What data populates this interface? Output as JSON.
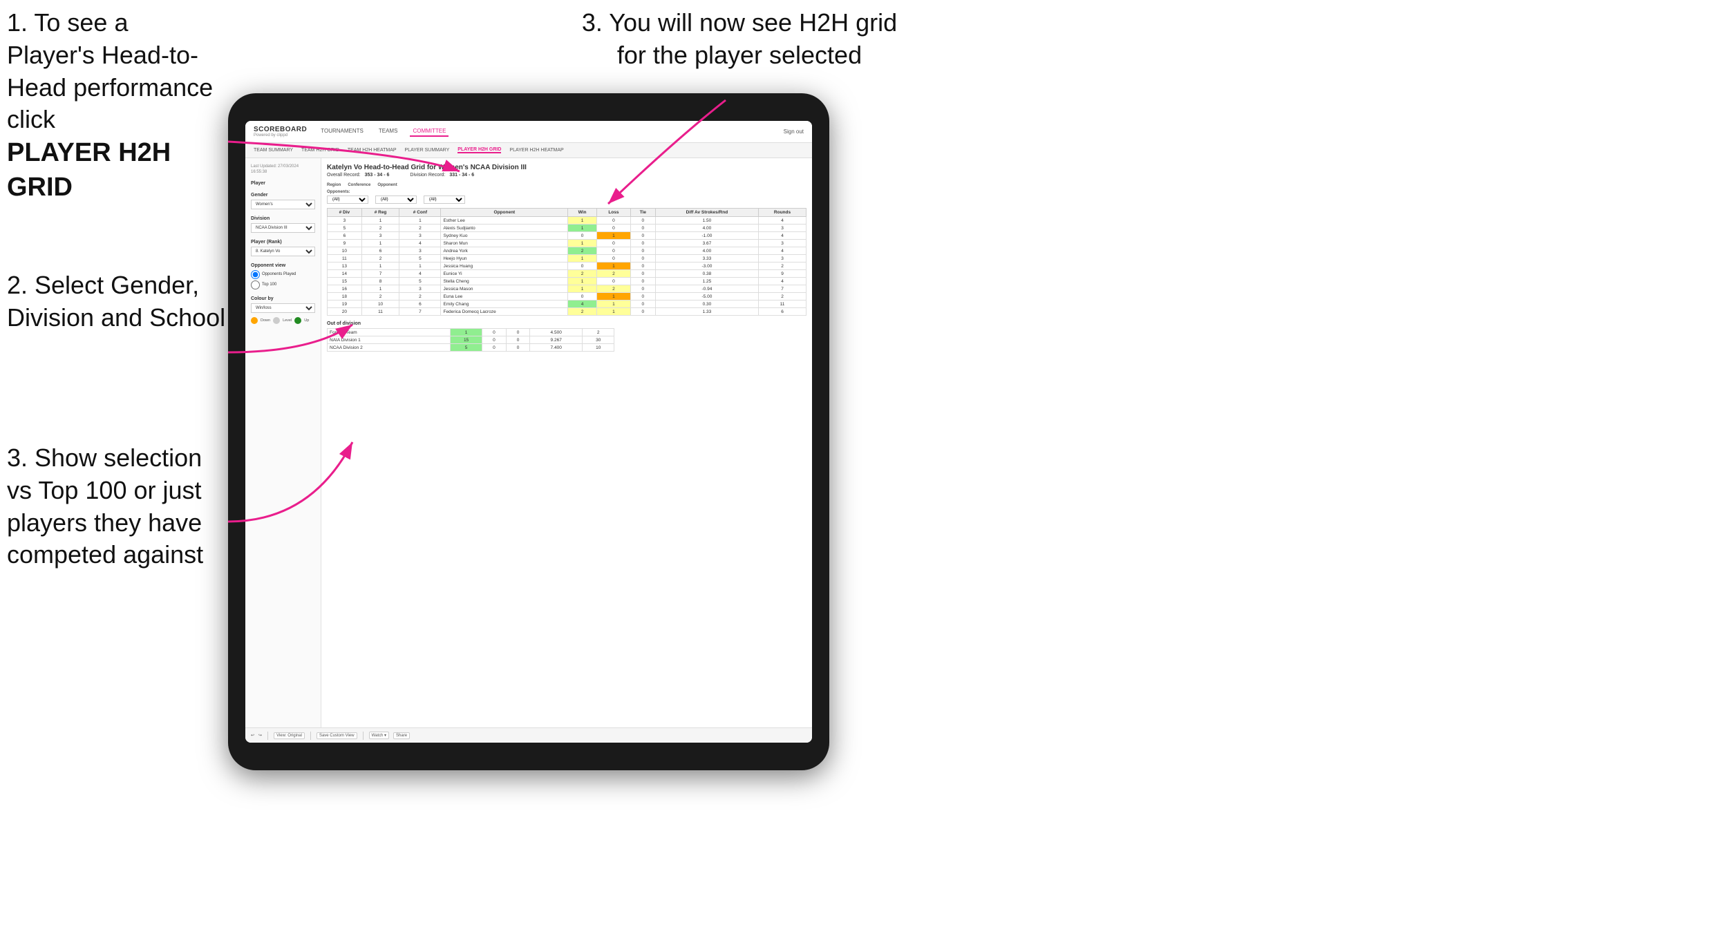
{
  "instructions": {
    "top_left_1": "1. To see a Player's Head-to-Head performance click",
    "top_left_1_bold": "PLAYER H2H GRID",
    "mid_left_2": "2. Select Gender, Division and School",
    "bot_left_3": "3. Show selection vs Top 100 or just players they have competed against",
    "top_right_3": "3. You will now see H2H grid for the player selected"
  },
  "nav": {
    "logo": "SCOREBOARD",
    "logo_sub": "Powered by clippd",
    "links": [
      "TOURNAMENTS",
      "TEAMS",
      "COMMITTEE"
    ],
    "active_link": "COMMITTEE",
    "sign_out": "Sign out"
  },
  "sub_nav": {
    "links": [
      "TEAM SUMMARY",
      "TEAM H2H GRID",
      "TEAM H2H HEATMAP",
      "PLAYER SUMMARY",
      "PLAYER H2H GRID",
      "PLAYER H2H HEATMAP"
    ],
    "active": "PLAYER H2H GRID"
  },
  "left_panel": {
    "last_updated_label": "Last Updated: 27/03/2024",
    "last_updated_time": "16:55:38",
    "player_label": "Player",
    "gender_label": "Gender",
    "gender_value": "Women's",
    "division_label": "Division",
    "division_value": "NCAA Division III",
    "player_rank_label": "Player (Rank)",
    "player_rank_value": "8. Katelyn Vo",
    "opponent_view_label": "Opponent view",
    "radio_opponents": "Opponents Played",
    "radio_top100": "Top 100",
    "colour_by_label": "Colour by",
    "colour_by_value": "Win/loss",
    "legend_down": "Down",
    "legend_level": "Level",
    "legend_up": "Up"
  },
  "grid": {
    "title": "Katelyn Vo Head-to-Head Grid for Women's NCAA Division III",
    "overall_record_label": "Overall Record:",
    "overall_record": "353 - 34 - 6",
    "division_record_label": "Division Record:",
    "division_record": "331 - 34 - 6",
    "region_label": "Region",
    "conference_label": "Conference",
    "opponent_label": "Opponent",
    "opponents_label": "Opponents:",
    "opponents_filter": "(All)",
    "conference_filter": "(All)",
    "opponent_filter": "(All)",
    "col_headers": [
      "# Div",
      "# Reg",
      "# Conf",
      "Opponent",
      "Win",
      "Loss",
      "Tie",
      "Diff Av Strokes/Rnd",
      "Rounds"
    ],
    "rows": [
      {
        "div": "3",
        "reg": "1",
        "conf": "1",
        "opponent": "Esther Lee",
        "win": "1",
        "loss": "0",
        "tie": "0",
        "diff": "1.50",
        "rounds": "4",
        "win_color": "yellow",
        "loss_color": "",
        "tie_color": ""
      },
      {
        "div": "5",
        "reg": "2",
        "conf": "2",
        "opponent": "Alexis Sudjianto",
        "win": "1",
        "loss": "0",
        "tie": "0",
        "diff": "4.00",
        "rounds": "3",
        "win_color": "green",
        "loss_color": "",
        "tie_color": ""
      },
      {
        "div": "6",
        "reg": "3",
        "conf": "3",
        "opponent": "Sydney Kuo",
        "win": "0",
        "loss": "1",
        "tie": "0",
        "diff": "-1.00",
        "rounds": "4",
        "win_color": "",
        "loss_color": "orange",
        "tie_color": ""
      },
      {
        "div": "9",
        "reg": "1",
        "conf": "4",
        "opponent": "Sharon Mun",
        "win": "1",
        "loss": "0",
        "tie": "0",
        "diff": "3.67",
        "rounds": "3",
        "win_color": "yellow",
        "loss_color": "",
        "tie_color": ""
      },
      {
        "div": "10",
        "reg": "6",
        "conf": "3",
        "opponent": "Andrea York",
        "win": "2",
        "loss": "0",
        "tie": "0",
        "diff": "4.00",
        "rounds": "4",
        "win_color": "green",
        "loss_color": "",
        "tie_color": ""
      },
      {
        "div": "11",
        "reg": "2",
        "conf": "5",
        "opponent": "Heejo Hyun",
        "win": "1",
        "loss": "0",
        "tie": "0",
        "diff": "3.33",
        "rounds": "3",
        "win_color": "yellow",
        "loss_color": "",
        "tie_color": ""
      },
      {
        "div": "13",
        "reg": "1",
        "conf": "1",
        "opponent": "Jessica Huang",
        "win": "0",
        "loss": "1",
        "tie": "0",
        "diff": "-3.00",
        "rounds": "2",
        "win_color": "",
        "loss_color": "orange",
        "tie_color": ""
      },
      {
        "div": "14",
        "reg": "7",
        "conf": "4",
        "opponent": "Eunice Yi",
        "win": "2",
        "loss": "2",
        "tie": "0",
        "diff": "0.38",
        "rounds": "9",
        "win_color": "yellow",
        "loss_color": "yellow",
        "tie_color": ""
      },
      {
        "div": "15",
        "reg": "8",
        "conf": "5",
        "opponent": "Stella Cheng",
        "win": "1",
        "loss": "0",
        "tie": "0",
        "diff": "1.25",
        "rounds": "4",
        "win_color": "yellow",
        "loss_color": "",
        "tie_color": ""
      },
      {
        "div": "16",
        "reg": "1",
        "conf": "3",
        "opponent": "Jessica Mason",
        "win": "1",
        "loss": "2",
        "tie": "0",
        "diff": "-0.94",
        "rounds": "7",
        "win_color": "yellow",
        "loss_color": "yellow",
        "tie_color": ""
      },
      {
        "div": "18",
        "reg": "2",
        "conf": "2",
        "opponent": "Euna Lee",
        "win": "0",
        "loss": "1",
        "tie": "0",
        "diff": "-5.00",
        "rounds": "2",
        "win_color": "",
        "loss_color": "orange",
        "tie_color": ""
      },
      {
        "div": "19",
        "reg": "10",
        "conf": "6",
        "opponent": "Emily Chang",
        "win": "4",
        "loss": "1",
        "tie": "0",
        "diff": "0.30",
        "rounds": "11",
        "win_color": "green",
        "loss_color": "yellow",
        "tie_color": ""
      },
      {
        "div": "20",
        "reg": "11",
        "conf": "7",
        "opponent": "Federica Domecq Lacroze",
        "win": "2",
        "loss": "1",
        "tie": "0",
        "diff": "1.33",
        "rounds": "6",
        "win_color": "yellow",
        "loss_color": "yellow",
        "tie_color": ""
      }
    ],
    "out_of_division_label": "Out of division",
    "out_of_division_rows": [
      {
        "team": "Foreign Team",
        "win": "1",
        "loss": "0",
        "tie": "0",
        "diff": "4.500",
        "rounds": "2"
      },
      {
        "team": "NAIA Division 1",
        "win": "15",
        "loss": "0",
        "tie": "0",
        "diff": "9.267",
        "rounds": "30"
      },
      {
        "team": "NCAA Division 2",
        "win": "5",
        "loss": "0",
        "tie": "0",
        "diff": "7.400",
        "rounds": "10"
      }
    ]
  },
  "toolbar": {
    "undo": "↩",
    "redo": "↪",
    "view_original": "View: Original",
    "save_custom": "Save Custom View",
    "watch": "Watch ▾",
    "share": "Share"
  },
  "colors": {
    "active_nav": "#e91e8c",
    "cell_green": "#90EE90",
    "cell_dark_green": "#228B22",
    "cell_yellow": "#FFFF99",
    "cell_orange": "#FFA500",
    "legend_down": "#FFA500",
    "legend_level": "#cccccc",
    "legend_up": "#228B22"
  }
}
